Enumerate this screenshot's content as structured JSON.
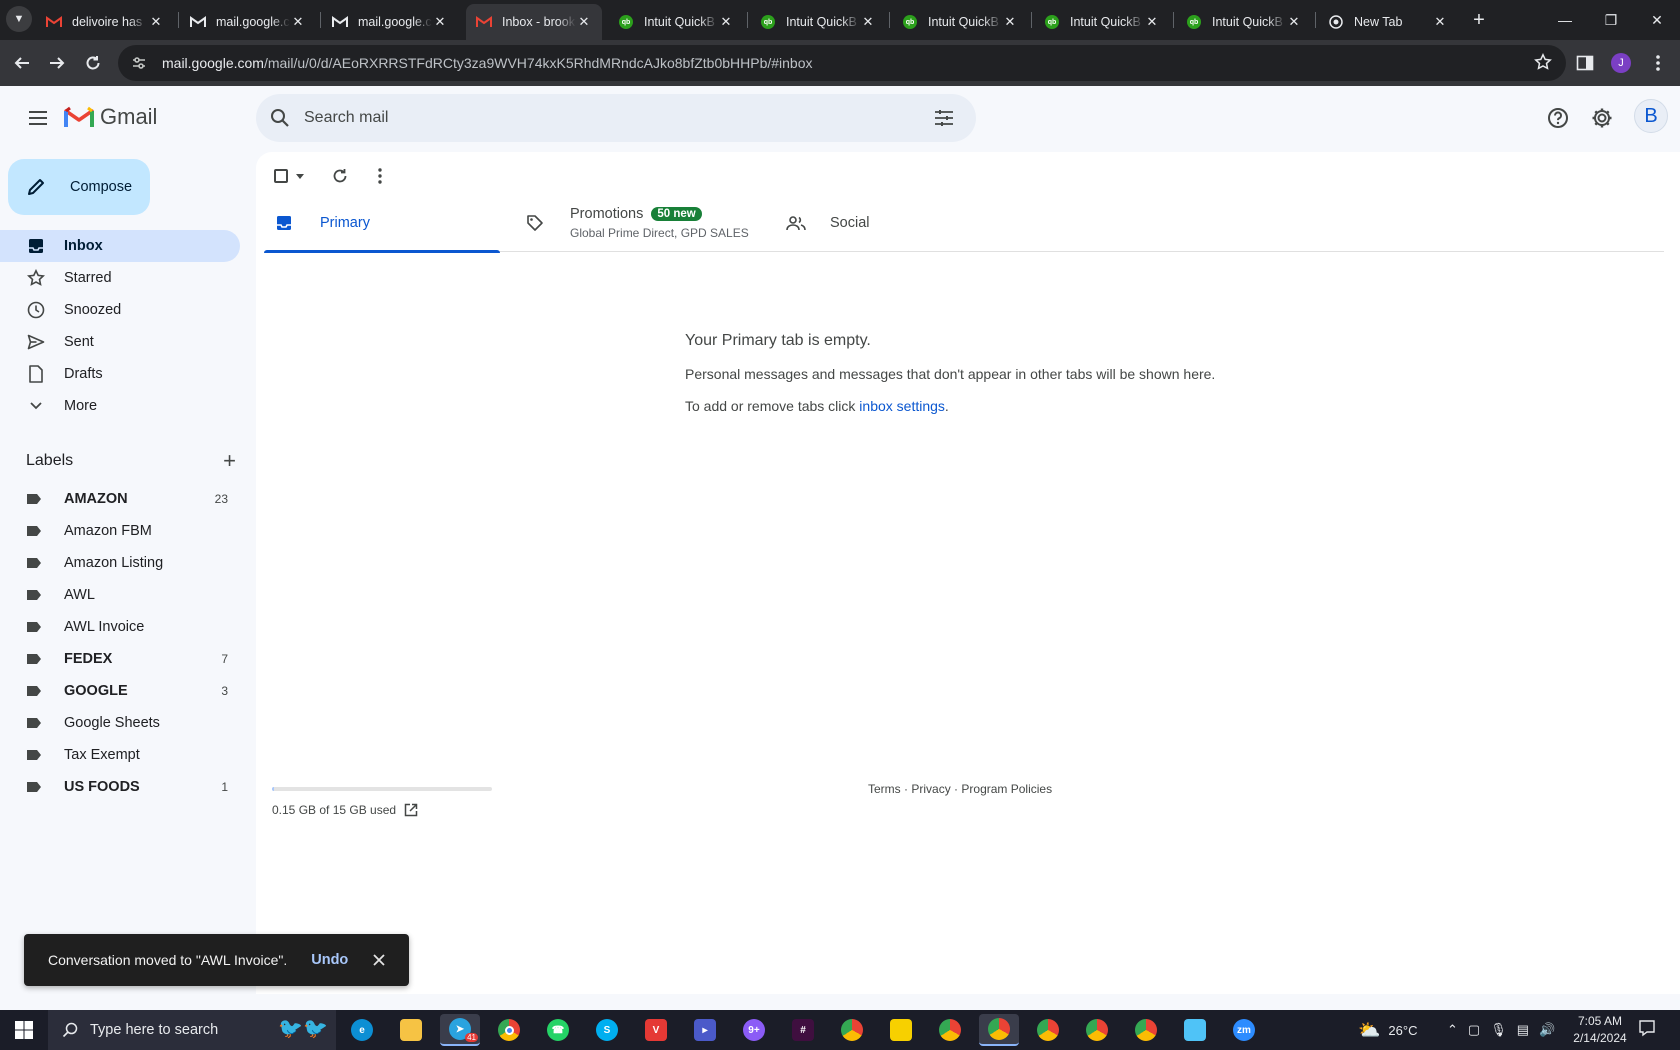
{
  "browser": {
    "tabs": [
      {
        "title": "delivoire has",
        "icon": "gmail-icon",
        "active": false
      },
      {
        "title": "mail.google.c",
        "icon": "gmail-icon",
        "active": false
      },
      {
        "title": "mail.google.c",
        "icon": "gmail-icon",
        "active": false
      },
      {
        "title": "Inbox - brook",
        "icon": "gmail-icon",
        "active": true
      },
      {
        "title": "Intuit QuickB",
        "icon": "quickbooks-icon",
        "active": false
      },
      {
        "title": "Intuit QuickB",
        "icon": "quickbooks-icon",
        "active": false
      },
      {
        "title": "Intuit QuickB",
        "icon": "quickbooks-icon",
        "active": false
      },
      {
        "title": "Intuit QuickB",
        "icon": "quickbooks-icon",
        "active": false
      },
      {
        "title": "Intuit QuickB",
        "icon": "quickbooks-icon",
        "active": false
      },
      {
        "title": "New Tab",
        "icon": "chrome-icon",
        "active": false
      }
    ],
    "url_host": "mail.google.com",
    "url_path": "/mail/u/0/d/AEoRXRRSTFdRCty3za9WVH74kxK5RhdMRndcAJko8bfZtb0bHHPb/#inbox",
    "profile_initial": "J"
  },
  "gmail": {
    "logo_text": "Gmail",
    "search_placeholder": "Search mail",
    "avatar_initial": "B",
    "compose_label": "Compose",
    "nav": [
      {
        "label": "Inbox",
        "icon": "inbox-icon",
        "active": true
      },
      {
        "label": "Starred",
        "icon": "star-icon",
        "active": false
      },
      {
        "label": "Snoozed",
        "icon": "clock-icon",
        "active": false
      },
      {
        "label": "Sent",
        "icon": "send-icon",
        "active": false
      },
      {
        "label": "Drafts",
        "icon": "draft-icon",
        "active": false
      },
      {
        "label": "More",
        "icon": "chevron-down-icon",
        "active": false
      }
    ],
    "labels_heading": "Labels",
    "labels": [
      {
        "name": "AMAZON",
        "count": "23",
        "bold": true
      },
      {
        "name": "Amazon FBM",
        "count": "",
        "bold": false
      },
      {
        "name": "Amazon Listing",
        "count": "",
        "bold": false
      },
      {
        "name": "AWL",
        "count": "",
        "bold": false
      },
      {
        "name": "AWL Invoice",
        "count": "",
        "bold": false
      },
      {
        "name": "FEDEX",
        "count": "7",
        "bold": true
      },
      {
        "name": "GOOGLE",
        "count": "3",
        "bold": true
      },
      {
        "name": "Google Sheets",
        "count": "",
        "bold": false
      },
      {
        "name": "Tax Exempt",
        "count": "",
        "bold": false
      },
      {
        "name": "US FOODS",
        "count": "1",
        "bold": true
      }
    ],
    "inbox_tabs": {
      "primary": "Primary",
      "promotions": "Promotions",
      "promotions_badge": "50 new",
      "promotions_sub": "Global Prime Direct, GPD SALES",
      "social": "Social"
    },
    "empty": {
      "heading": "Your Primary tab is empty.",
      "line1": "Personal messages and messages that don't appear in other tabs will be shown here.",
      "line2_prefix": "To add or remove tabs click ",
      "line2_link": "inbox settings",
      "line2_suffix": "."
    },
    "storage": {
      "text": "0.15 GB of 15 GB used",
      "used_fraction": 0.01
    },
    "footer": {
      "terms": "Terms",
      "privacy": "Privacy",
      "policies": "Program Policies",
      "sep": "·"
    },
    "snackbar": {
      "message": "Conversation moved to \"AWL Invoice\".",
      "undo": "Undo"
    }
  },
  "taskbar": {
    "search_placeholder": "Type here to search",
    "telegram_badge": "41",
    "weather": "26°C",
    "time": "7:05 AM",
    "date": "2/14/2024"
  },
  "colors": {
    "accent": "#0b57d0",
    "compose_bg": "#c2e7ff",
    "active_nav_bg": "#d3e3fd",
    "badge_green": "#188038"
  }
}
